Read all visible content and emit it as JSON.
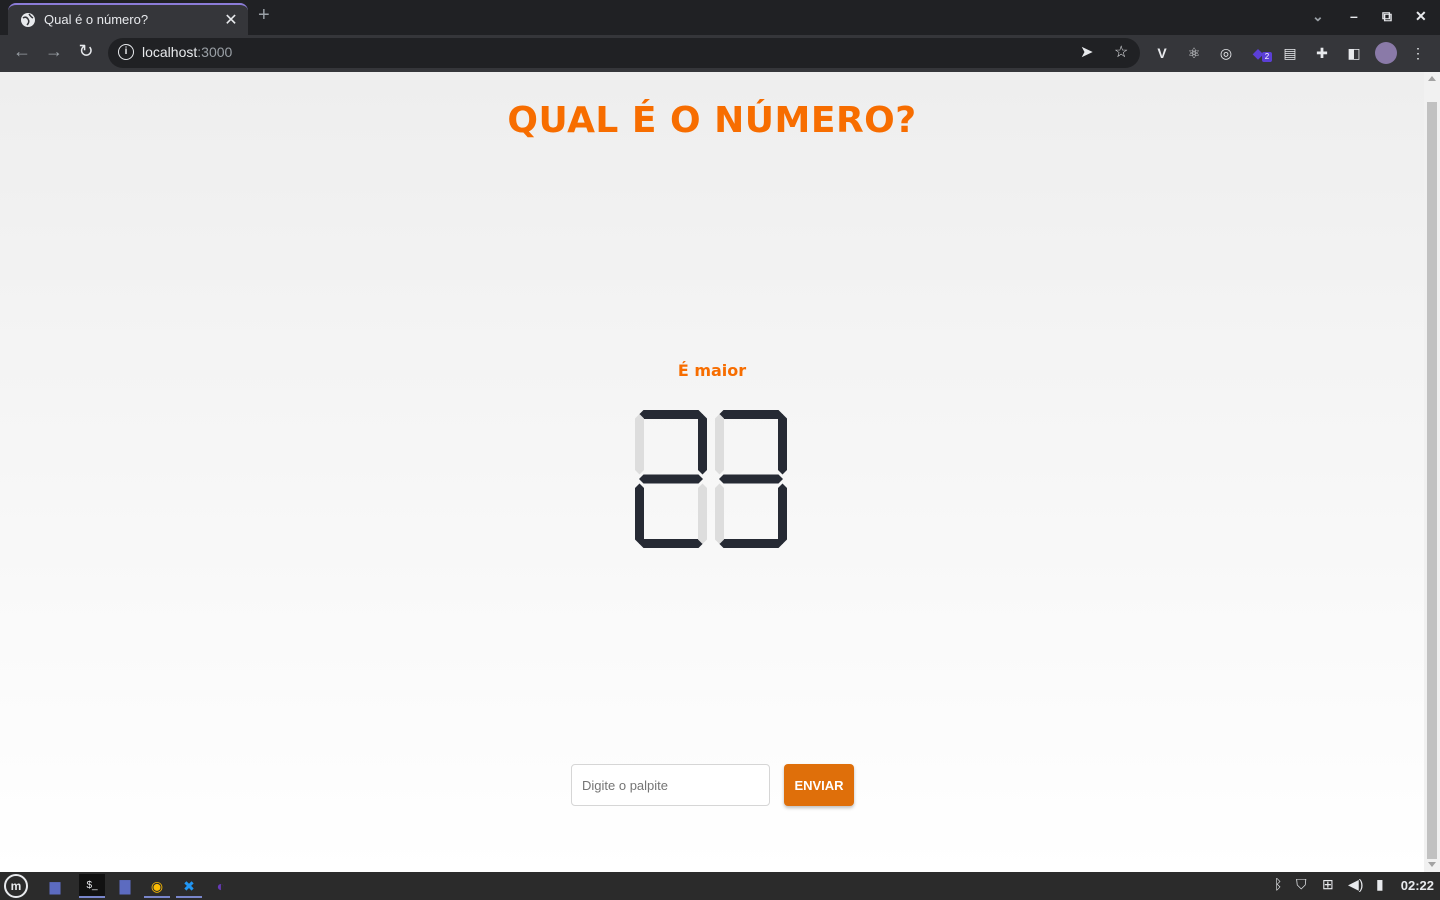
{
  "browser": {
    "tab_title": "Qual é o número?",
    "tab_close": "✕",
    "new_tab": "+",
    "url_host": "localhost",
    "url_port": ":3000",
    "window_controls": {
      "minimize": "–",
      "maximize": "⧉",
      "close": "✕"
    }
  },
  "page": {
    "title": "QUAL É O NÚMERO?",
    "hint": "É maior",
    "display_value": "23",
    "guess_input": {
      "placeholder": "Digite o palpite",
      "value": ""
    },
    "submit_label": "ENVIAR"
  },
  "extensions": {
    "badge_count": "2"
  },
  "taskbar": {
    "clock": "02:22"
  },
  "colors": {
    "accent": "#f76d00",
    "button": "#df6f0a",
    "segment_on": "#262a34",
    "segment_off": "#dddddd"
  }
}
